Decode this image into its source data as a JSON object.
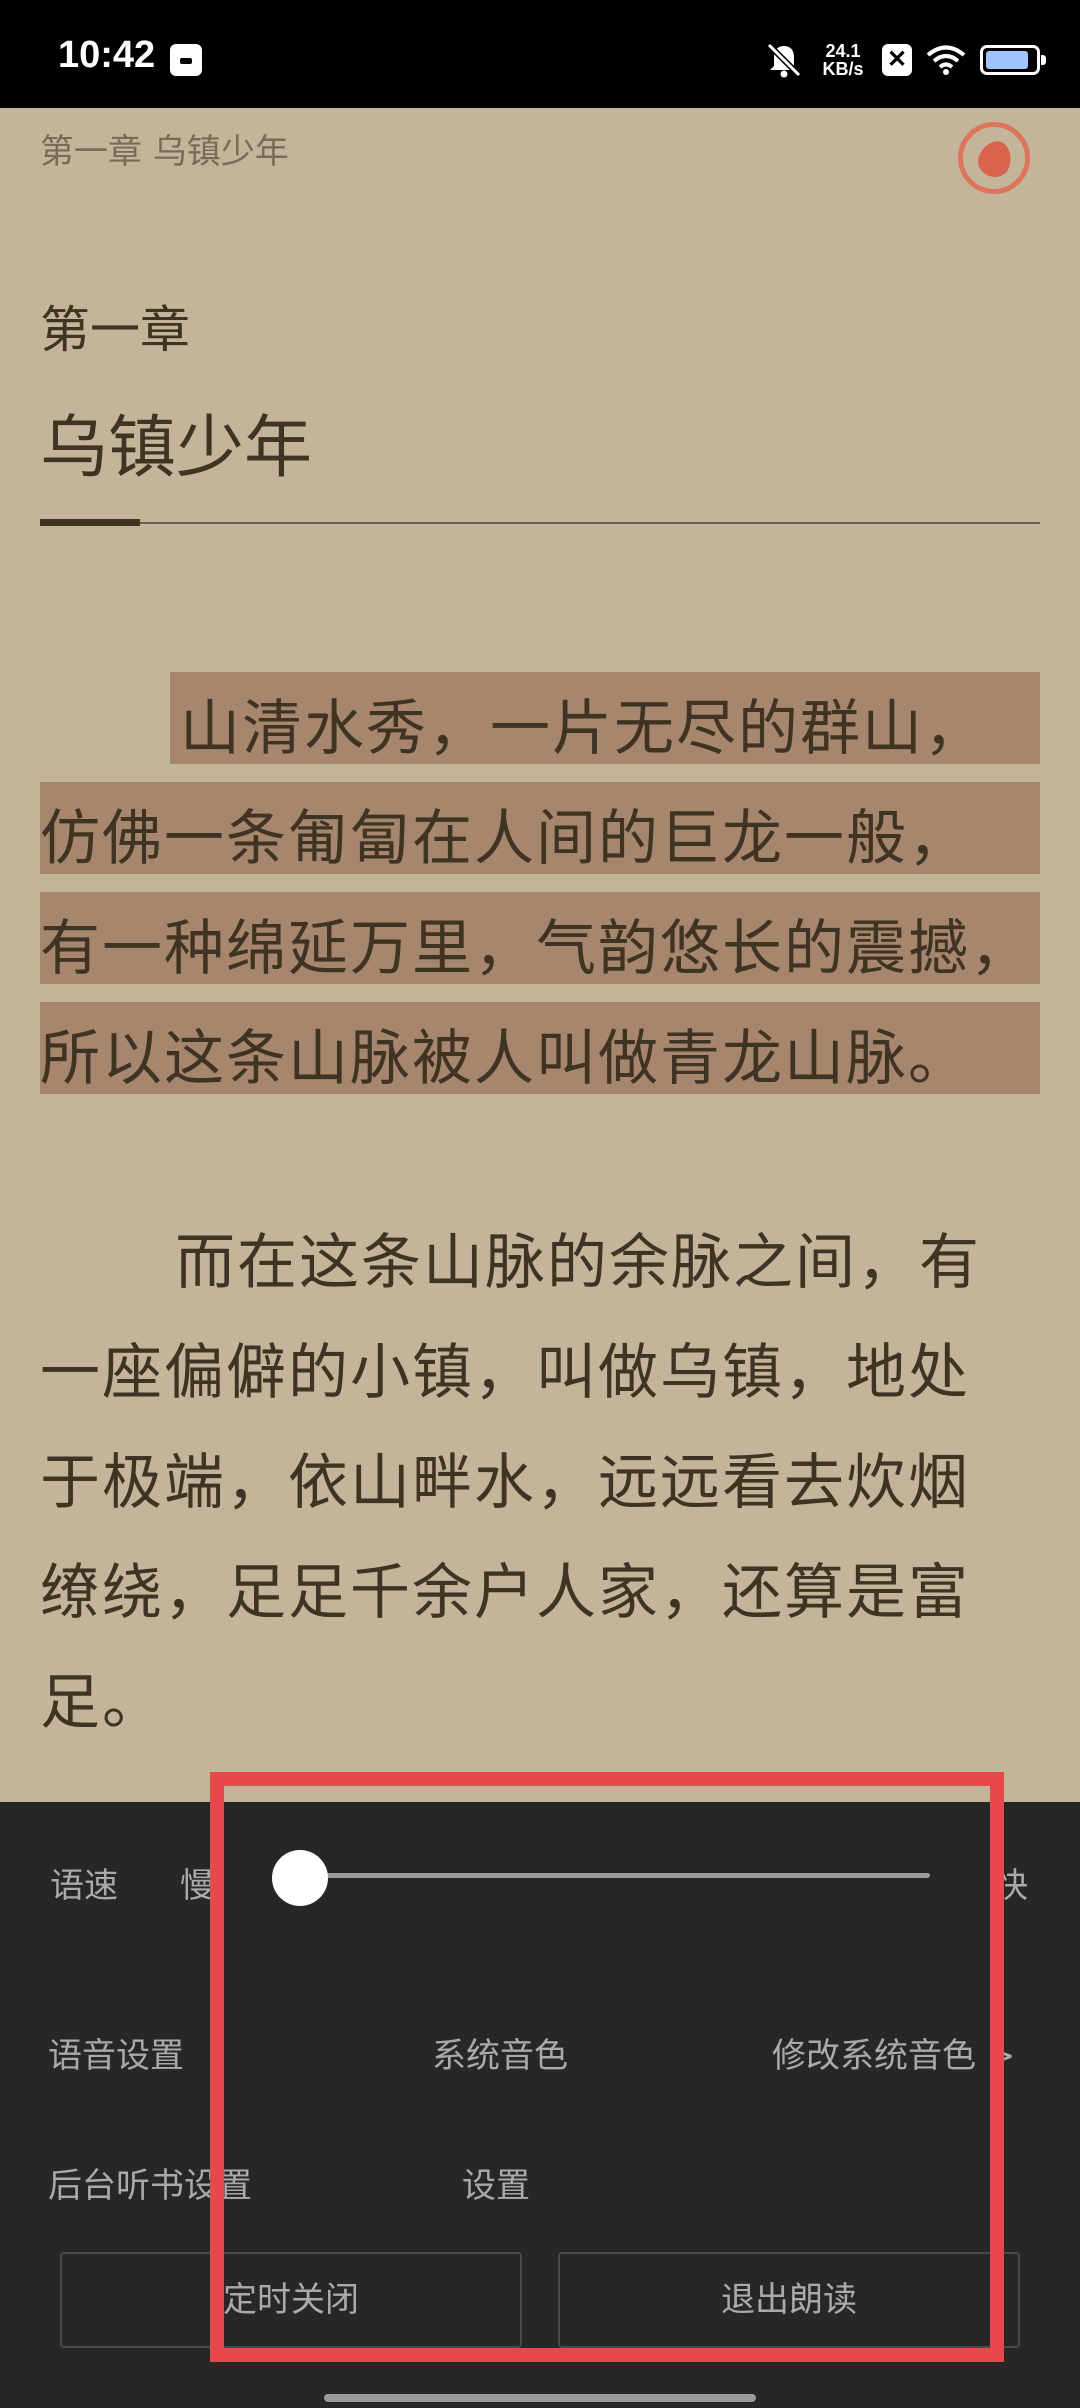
{
  "status_bar": {
    "time": "10:42",
    "net_speed_value": "24.1",
    "net_speed_unit": "KB/s",
    "icons": [
      "app-notification-icon",
      "bell-muted-icon",
      "close-box-icon",
      "wifi-icon",
      "battery-icon"
    ],
    "battery_level": 0.8
  },
  "reader": {
    "running_header": "第一章 乌镇少年",
    "chapter_number": "第一章",
    "chapter_title": "乌镇少年",
    "highlighted_lines": [
      "山清水秀，一片无尽的群山，",
      "仿佛一条匍匐在人间的巨龙一般，",
      "有一种绵延万里，气韵悠长的震撼，",
      "所以这条山脉被人叫做青龙山脉。"
    ],
    "paragraph2_lines": [
      "而在这条山脉的余脉之间，有",
      "一座偏僻的小镇，叫做乌镇，地处",
      "于极端，依山畔水，远远看去炊烟",
      "缭绕，足足千余户人家，还算是富",
      "足。"
    ],
    "highlight_color": "#a6866d",
    "background_color": "#c2b59a"
  },
  "tts_panel": {
    "speed_label": "语速",
    "speed_slow": "慢",
    "speed_fast": "快",
    "speed_level": 0,
    "voice_label": "语音设置",
    "voice_value": "系统音色",
    "voice_modify": "修改系统音色 >",
    "background_label": "后台听书设置",
    "background_value": "设置",
    "timer_button": "定时关闭",
    "exit_button": "退出朗读"
  },
  "annotation_color": "#e8474b"
}
